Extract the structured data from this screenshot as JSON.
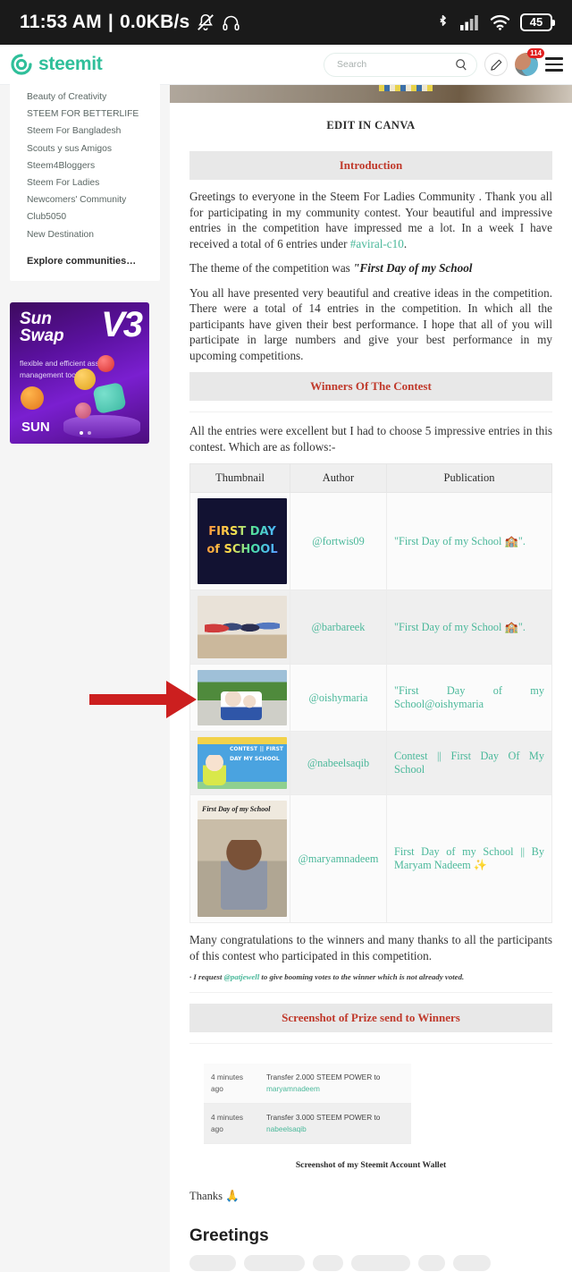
{
  "statusbar": {
    "time": "11:53 AM",
    "separator": "|",
    "network_speed": "0.0KB/s",
    "mute_icon": "bell-muted-icon",
    "headphone_icon": "headphone-icon",
    "bluetooth_icon": "bluetooth-icon",
    "signal_icon": "cellular-signal-icon",
    "wifi_icon": "wifi-icon",
    "battery_level": "45"
  },
  "header": {
    "logo_icon": "steemit-logo-icon",
    "brand": "steemit",
    "search_placeholder": "Search",
    "search_value": "",
    "search_icon": "search-icon",
    "pencil_icon": "pencil-icon",
    "avatar_icon": "avatar",
    "notification_count": "114",
    "menu_icon": "hamburger-menu-icon",
    "accent_color": "#2fbf9a"
  },
  "sidebar": {
    "communities": [
      "Beauty of Creativity",
      "STEEM FOR BETTERLIFE",
      "Steem For Bangladesh",
      "Scouts y sus Amigos",
      "Steem4Bloggers",
      "Steem For Ladies",
      "Newcomers' Community",
      "Club5050",
      "New Destination"
    ],
    "explore_label": "Explore communities…",
    "ad": {
      "title_line1": "Sun",
      "title_line2": "Swap",
      "version": "V3",
      "subtitle": "flexible and efficient asset management tool",
      "token": "SUN"
    }
  },
  "article": {
    "hero_caption": "EDIT IN CANVA",
    "section_intro": "Introduction",
    "p1_a": "Greetings to everyone in the Steem For Ladies Community . Thank you all for participating in my community contest. Your beautiful and impressive entries in the competition have impressed me a lot. In a week I have received a total of 6 entries under ",
    "p1_tag": "#aviral-c10",
    "p1_b": ".",
    "p2_a": "The theme of the competition was ",
    "p2_em": "\"First Day of my School",
    "p3": "You all have presented very beautiful and creative ideas in the competition. There were a total of 14 entries in the competition. In which all the participants have given their best performance. I hope that all of you will participate in large numbers and give your best performance in my upcoming competitions.",
    "section_winners": "Winners Of The Contest",
    "p4": "All the entries were excellent but I had to choose 5 impressive entries in this contest. Which are as follows:-",
    "table": {
      "headers": [
        "Thumbnail",
        "Author",
        "Publication"
      ],
      "rows": [
        {
          "thumb": "first-day-of-school-neon-thumbnail",
          "author": "@fortwis09",
          "publication": "\"First Day of my School 🏫\"."
        },
        {
          "thumb": "children-jumping-photo-thumbnail",
          "author": "@barbareek",
          "publication": "\"First Day of my School 🏫\"."
        },
        {
          "thumb": "mother-and-child-photo-thumbnail",
          "author": "@oishymaria",
          "publication": "\"First Day of my School@oishymaria"
        },
        {
          "thumb": "contest-cartoon-girl-thumbnail",
          "author": "@nabeelsaqib",
          "publication": "Contest || First Day Of My School"
        },
        {
          "thumb": "girl-with-plant-photo-thumbnail",
          "author": "@maryamnadeem",
          "publication": "First Day of my School || By Maryam Nadeem ✨"
        }
      ]
    },
    "p5": "Many congratulations to the winners and many thanks to all the participants of this contest who participated in this competition.",
    "footnote_a": "· I request ",
    "footnote_link": "@patjewell",
    "footnote_b": " to give booming votes to the winner which is not already voted.",
    "section_screenshot": "Screenshot of Prize send to Winners",
    "wallet": {
      "rows": [
        {
          "time": "4 minutes ago",
          "desc": "Transfer 2.000 STEEM POWER to ",
          "user": "maryamnadeem"
        },
        {
          "time": "4 minutes ago",
          "desc": "Transfer 3.000 STEEM POWER to ",
          "user": "nabeelsaqib"
        }
      ],
      "caption": "Screenshot of my Steemit Account Wallet"
    },
    "thanks": "Thanks 🙏",
    "greetings_heading": "Greetings",
    "tags": [
      "",
      "",
      "",
      "",
      "",
      ""
    ]
  },
  "annotation": {
    "arrow_color": "#cc1f1f",
    "arrow_name": "red-arrow-pointing-to-oishymaria-row"
  }
}
